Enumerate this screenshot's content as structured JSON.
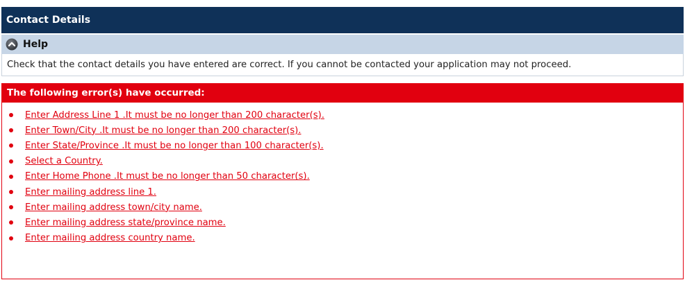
{
  "section": {
    "title": "Contact Details"
  },
  "help": {
    "label": "Help",
    "icon": "chevron-up-circle-icon",
    "text": "Check that the contact details you have entered are correct. If you cannot be contacted your application may not proceed."
  },
  "errors": {
    "title": "The following error(s) have occurred:",
    "items": [
      "Enter Address Line 1 .It must be no longer than 200 character(s).",
      "Enter Town/City .It must be no longer than 200 character(s).",
      "Enter State/Province .It must be no longer than 100 character(s).",
      "Select a Country.",
      "Enter Home Phone .It must be no longer than 50 character(s).",
      "Enter mailing address line 1.",
      "Enter mailing address town/city name.",
      "Enter mailing address state/province name.",
      "Enter mailing address country name."
    ]
  },
  "colors": {
    "header_bg": "#0f3158",
    "help_bg": "#c6d5e6",
    "error_red": "#e1000f"
  }
}
